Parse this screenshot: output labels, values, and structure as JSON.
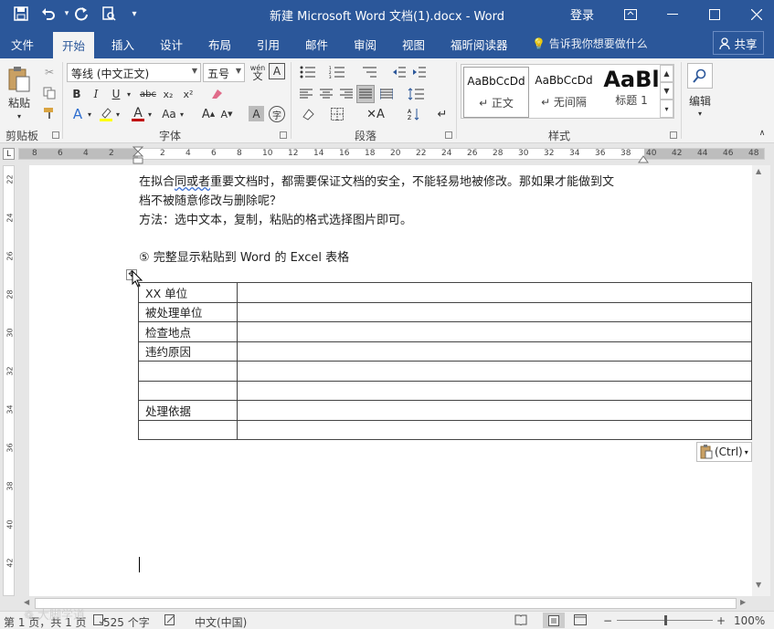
{
  "window": {
    "title": "新建 Microsoft Word 文档(1).docx - Word",
    "login": "登录"
  },
  "tabs": [
    {
      "label": "文件"
    },
    {
      "label": "开始",
      "active": true
    },
    {
      "label": "插入"
    },
    {
      "label": "设计"
    },
    {
      "label": "布局"
    },
    {
      "label": "引用"
    },
    {
      "label": "邮件"
    },
    {
      "label": "审阅"
    },
    {
      "label": "视图"
    },
    {
      "label": "福昕阅读器"
    },
    {
      "label": "告诉我你想要做什么"
    }
  ],
  "share_label": "共享",
  "ribbon": {
    "paste_label": "粘贴",
    "font_name": "等线 (中文正文)",
    "font_size": "五号",
    "styles": [
      {
        "preview": "AaBbCcDd",
        "name": "↵ 正文"
      },
      {
        "preview": "AaBbCcDd",
        "name": "↵ 无间隔"
      },
      {
        "preview": "AaBl",
        "name": "标题 1"
      }
    ],
    "edit_label": "编辑",
    "groups": {
      "clipboard": "剪贴板",
      "font": "字体",
      "paragraph": "段落",
      "styles": "样式"
    },
    "font_buttons": {
      "bold": "B",
      "italic": "I",
      "underline": "U",
      "strike": "abc",
      "sub": "x₂",
      "sup": "x²",
      "grow": "A",
      "shrink": "A",
      "case": "Aa",
      "clear_format": "A",
      "char_shade": "A",
      "phonetic": "wén",
      "char_border": "A",
      "enclose": "字"
    }
  },
  "ruler": {
    "h_ticks": [
      "8",
      "6",
      "4",
      "2",
      "",
      "2",
      "4",
      "6",
      "8",
      "10",
      "12",
      "14",
      "16",
      "18",
      "20",
      "22",
      "24",
      "26",
      "28",
      "30",
      "32",
      "34",
      "36",
      "38",
      "40",
      "42",
      "44",
      "46",
      "48"
    ],
    "v_ticks": [
      "22",
      "24",
      "26",
      "28",
      "30",
      "32",
      "34",
      "36",
      "38",
      "40",
      "42",
      "44"
    ]
  },
  "document": {
    "lines": [
      {
        "pre": "在拟合",
        "wavy": "同或者",
        "post": "重要文档时，都需要保证文档的安全，不能轻易地被修改。那如果才能做到文"
      },
      {
        "pre": "档不被随意修改与删除呢？",
        "wavy": "",
        "post": ""
      },
      {
        "pre": "方法：选中文本，复制，粘贴的格式选择图片即可。",
        "wavy": "",
        "post": ""
      }
    ],
    "heading": "⑤   完整显示粘贴到 Word 的 Excel 表格",
    "table_rows": [
      {
        "label": "XX 单位"
      },
      {
        "label": "被处理单位"
      },
      {
        "label": "检查地点"
      },
      {
        "label": "违约原因"
      },
      {
        "label": ""
      },
      {
        "label": ""
      },
      {
        "label": "处理依据"
      },
      {
        "label": ""
      }
    ]
  },
  "paste_options": "(Ctrl)",
  "status": {
    "page": "第 1 页，共 1 页",
    "words": "525 个字",
    "language": "中文(中国)",
    "zoom": "100%"
  },
  "watermark": "大脚学道",
  "colors": {
    "brand": "#2b579a",
    "highlight": "#ffff00",
    "font_color": "#c00000"
  }
}
